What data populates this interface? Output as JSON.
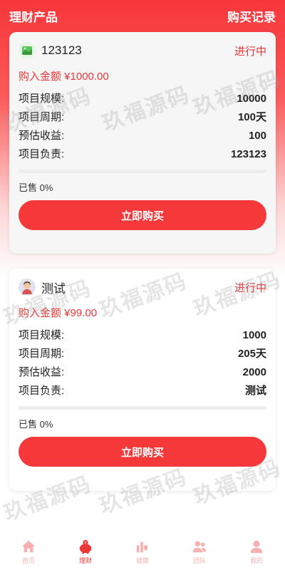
{
  "header": {
    "title": "理财产品",
    "records_label": "购买记录"
  },
  "products": [
    {
      "name": "123123",
      "status": "进行中",
      "buy_amount": "购入金额 ¥1000.00",
      "rows": [
        {
          "label": "项目规模:",
          "value": "10000"
        },
        {
          "label": "项目周期:",
          "value": "100天"
        },
        {
          "label": "预估收益:",
          "value": "100"
        },
        {
          "label": "项目负责:",
          "value": "123123"
        }
      ],
      "progress": 0,
      "sold": "已售 0%",
      "button": "立即购买",
      "avatar_icon": "green-landscape-icon"
    },
    {
      "name": "测试",
      "status": "进行中",
      "buy_amount": "购入金额 ¥99.00",
      "rows": [
        {
          "label": "项目规模:",
          "value": "1000"
        },
        {
          "label": "项目周期:",
          "value": "205天"
        },
        {
          "label": "预估收益:",
          "value": "2000"
        },
        {
          "label": "项目负责:",
          "value": "测试"
        }
      ],
      "progress": 0,
      "sold": "已售 0%",
      "button": "立即购买",
      "avatar_icon": "person-avatar-icon"
    }
  ],
  "tabbar": [
    {
      "label": "首页",
      "icon": "home-icon",
      "active": false
    },
    {
      "label": "理财",
      "icon": "piggy-bank-icon",
      "active": true
    },
    {
      "label": "健康",
      "icon": "health-icon",
      "active": false
    },
    {
      "label": "团队",
      "icon": "team-icon",
      "active": false
    },
    {
      "label": "我的",
      "icon": "user-icon",
      "active": false
    }
  ],
  "watermark": "玖福源码",
  "colors": {
    "accent": "#f5393b",
    "status": "#e8383a"
  }
}
